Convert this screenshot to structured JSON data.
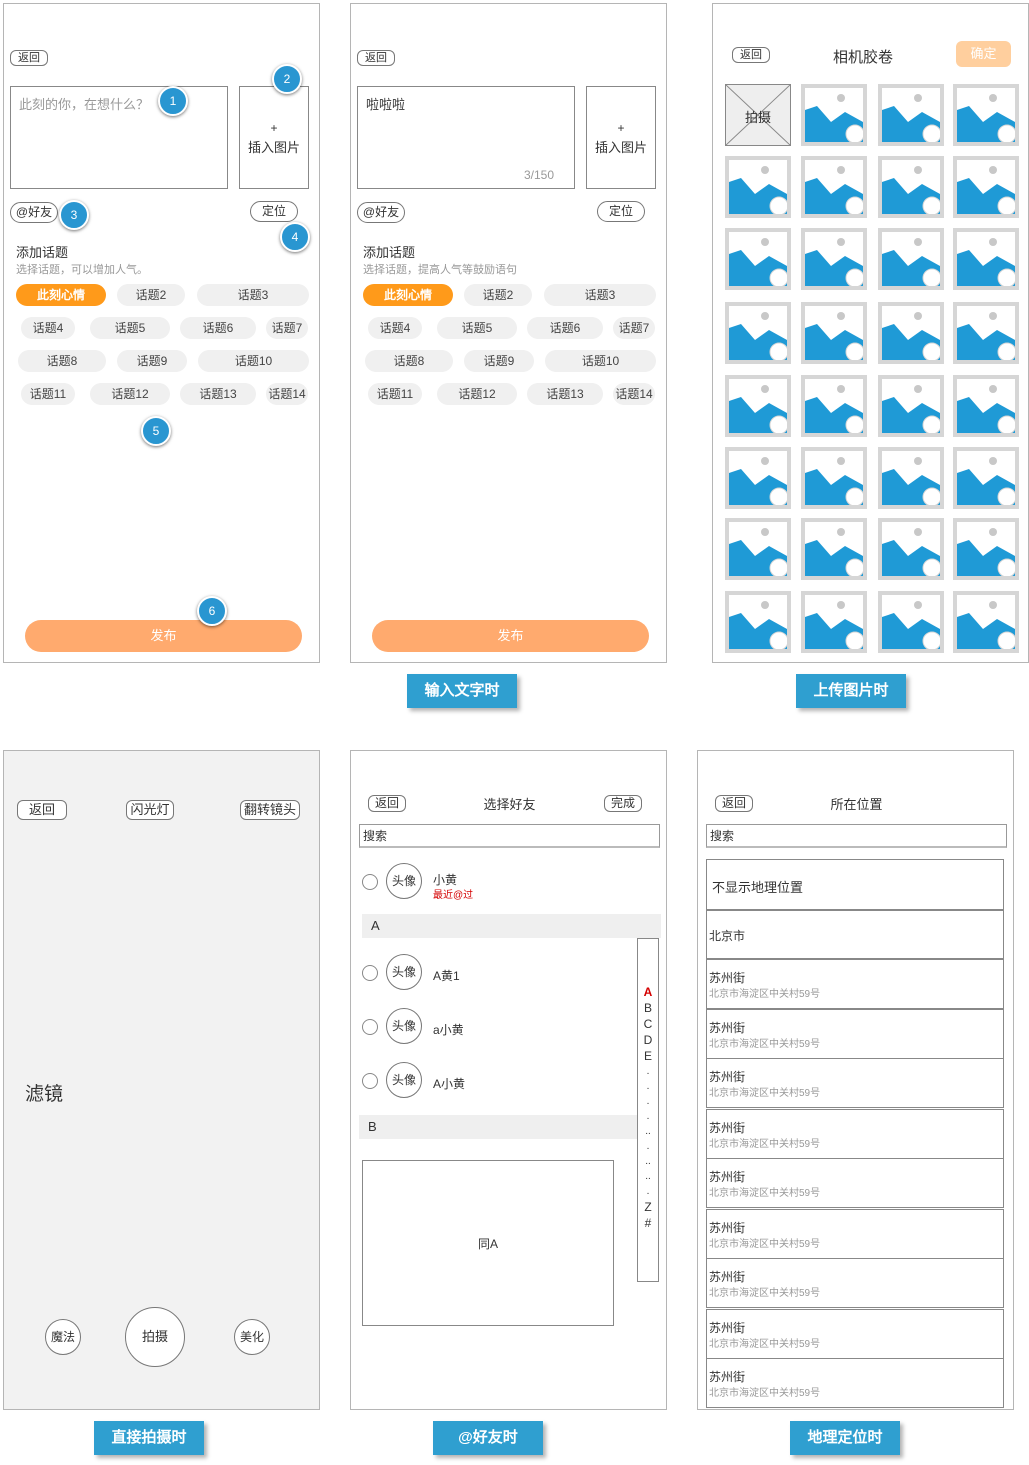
{
  "screen1": {
    "back": "返回",
    "text_placeholder": "此刻的你，在想什么？",
    "insert_plus": "+",
    "insert_label": "插入图片",
    "at_friend": "@好友",
    "locate": "定位",
    "topic_title": "添加话题",
    "topic_hint": "选择话题，可以增加人气。",
    "tags": [
      "此刻心情",
      "话题2",
      "话题3",
      "话题4",
      "话题5",
      "话题6",
      "话题7",
      "话题8",
      "话题9",
      "话题10",
      "话题11",
      "话题12",
      "话题13",
      "话题14"
    ],
    "publish": "发布",
    "badges": [
      "1",
      "2",
      "3",
      "4",
      "5",
      "6"
    ]
  },
  "screen2": {
    "back": "返回",
    "text_value": "啦啦啦",
    "counter": "3/150",
    "insert_plus": "+",
    "insert_label": "插入图片",
    "at_friend": "@好友",
    "locate": "定位",
    "topic_title": "添加话题",
    "topic_hint": "选择话题，提高人气等鼓励语句",
    "tags": [
      "此刻心情",
      "话题2",
      "话题3",
      "话题4",
      "话题5",
      "话题6",
      "话题7",
      "话题8",
      "话题9",
      "话题10",
      "话题11",
      "话题12",
      "话题13",
      "话题14"
    ],
    "publish": "发布"
  },
  "screen3": {
    "back": "返回",
    "title": "相机胶卷",
    "confirm": "确定",
    "shoot": "拍摄",
    "photo_icon": "image-placeholder-icon"
  },
  "screen4": {
    "back": "返回",
    "flash": "闪光灯",
    "flip": "翻转镜头",
    "filter": "滤镜",
    "magic": "魔法",
    "shoot": "拍摄",
    "beautify": "美化"
  },
  "screen5": {
    "back": "返回",
    "title": "选择好友",
    "done": "完成",
    "search": "搜索",
    "avatar": "头像",
    "recent_name": "小黄",
    "recent_note": "最近@过",
    "section_a": "A",
    "friends": [
      "A黄1",
      "a小黄",
      "A小黄"
    ],
    "section_b": "B",
    "same_as_a": "同A",
    "index": [
      "A",
      "B",
      "C",
      "D",
      "E",
      ".",
      ".",
      ".",
      ".",
      "..",
      ".",
      "..",
      "..",
      ".",
      "Z",
      "#"
    ]
  },
  "screen6": {
    "back": "返回",
    "title": "所在位置",
    "search": "搜索",
    "hide_location": "不显示地理位置",
    "city": "北京市",
    "places": [
      {
        "name": "苏州街",
        "address": "北京市海淀区中关村59号"
      },
      {
        "name": "苏州街",
        "address": "北京市海淀区中关村59号"
      },
      {
        "name": "苏州街",
        "address": "北京市海淀区中关村59号"
      },
      {
        "name": "苏州街",
        "address": "北京市海淀区中关村59号"
      },
      {
        "name": "苏州街",
        "address": "北京市海淀区中关村59号"
      },
      {
        "name": "苏州街",
        "address": "北京市海淀区中关村59号"
      },
      {
        "name": "苏州街",
        "address": "北京市海淀区中关村59号"
      },
      {
        "name": "苏州街",
        "address": "北京市海淀区中关村59号"
      },
      {
        "name": "苏州街",
        "address": "北京市海淀区中关村59号"
      }
    ]
  },
  "captions": {
    "text_input": "输入文字时",
    "upload_photo": "上传图片时",
    "direct_shoot": "直接拍摄时",
    "at_friend": "@好友时",
    "geo_location": "地理定位时"
  },
  "colors": {
    "accent_orange": "#ff9a1a",
    "publish_orange": "#ffaa6e",
    "badge_blue": "#2996d1",
    "caption_blue": "#2f9fd0",
    "photo_blue": "#1f9ad6",
    "recent_red": "#d40000"
  }
}
